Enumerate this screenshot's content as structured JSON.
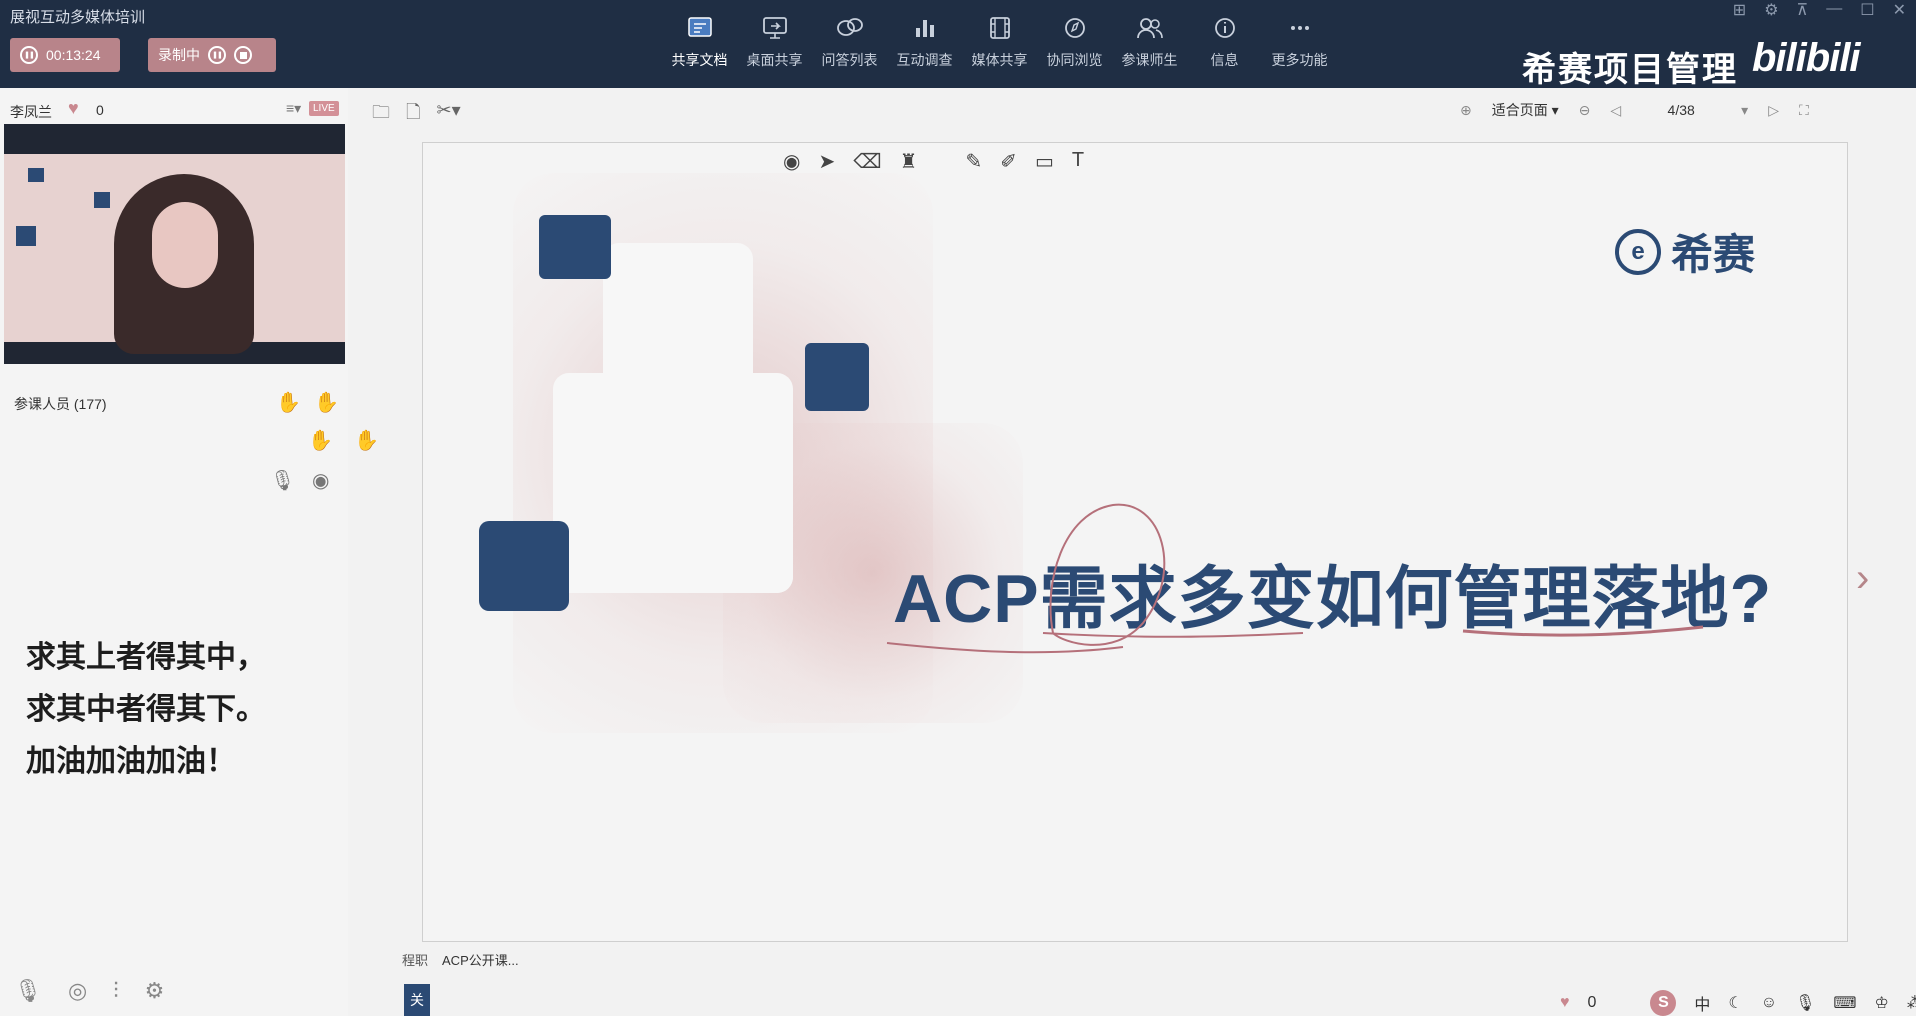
{
  "app": {
    "title": "展视互动多媒体培训"
  },
  "recording": {
    "timer": "00:13:24",
    "status_label": "录制中"
  },
  "toolbar": {
    "items": [
      {
        "label": "共享文档",
        "icon": "share-doc-icon"
      },
      {
        "label": "桌面共享",
        "icon": "desktop-share-icon"
      },
      {
        "label": "问答列表",
        "icon": "qa-list-icon"
      },
      {
        "label": "互动调查",
        "icon": "survey-chart-icon"
      },
      {
        "label": "媒体共享",
        "icon": "media-film-icon"
      },
      {
        "label": "协同浏览",
        "icon": "compass-icon"
      },
      {
        "label": "参课师生",
        "icon": "people-icon"
      },
      {
        "label": "信息",
        "icon": "info-icon"
      },
      {
        "label": "更多功能",
        "icon": "more-dots-icon"
      }
    ]
  },
  "brand": {
    "text": "希赛项目管理",
    "bilibili": "bilibili"
  },
  "teacher": {
    "name": "李凤兰",
    "likes": "0",
    "live_badge": "LIVE"
  },
  "participants": {
    "label": "参课人员 (177)"
  },
  "motto": {
    "line1": "求其上者得其中，",
    "line2": "求其中者得其下。",
    "line3": "加油加油加油！"
  },
  "viewer": {
    "zoom": "适合页面",
    "page": "4/38"
  },
  "slide": {
    "logo_mark": "e",
    "logo_text": "希赛",
    "headline": "ACP需求多变如何管理落地?"
  },
  "bottom": {
    "doc_tab_fragment": "程职",
    "doc_name": "ACP公开课...",
    "blue_tab": "关",
    "likes": "0",
    "ime": "中"
  },
  "colors": {
    "topbar": "#1f2e44",
    "accent_pink": "#b8848a",
    "slide_blue": "#2b4a74"
  }
}
